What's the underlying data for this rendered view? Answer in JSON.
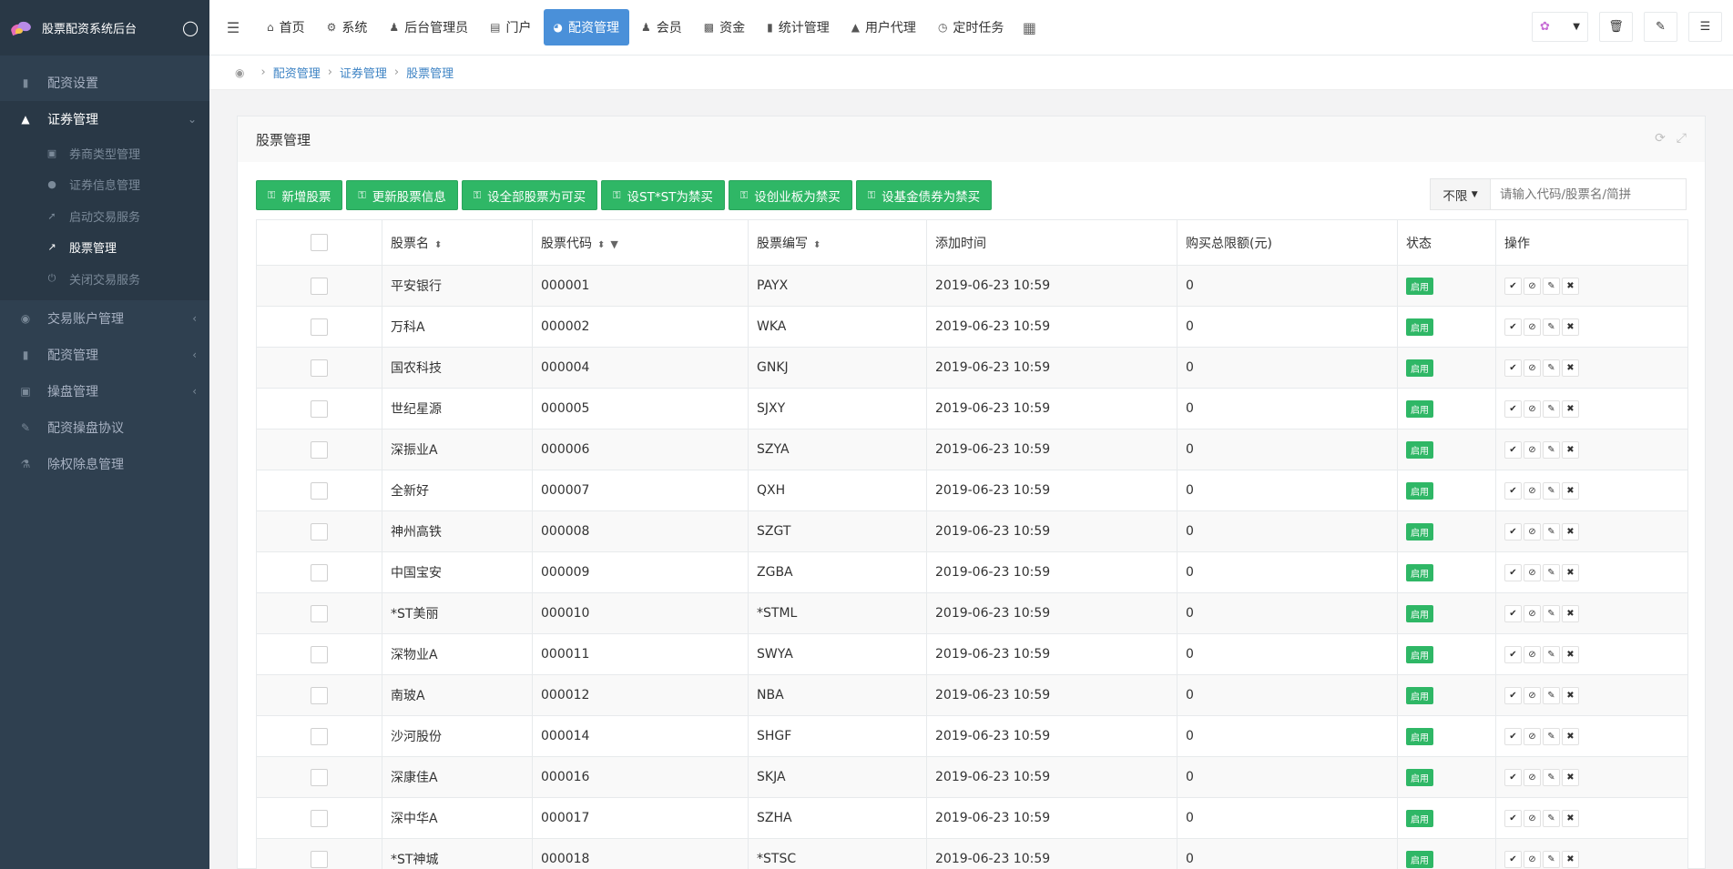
{
  "app": {
    "title": "股票配资系统后台"
  },
  "sidebar": {
    "items": [
      {
        "label": "配资设置",
        "icon": "signal-icon"
      },
      {
        "label": "证券管理",
        "icon": "area-chart-icon",
        "active": true
      },
      {
        "label": "交易账户管理",
        "icon": "user-circle-icon"
      },
      {
        "label": "配资管理",
        "icon": "thermometer-icon"
      },
      {
        "label": "操盘管理",
        "icon": "bank-icon"
      },
      {
        "label": "配资操盘协议",
        "icon": "pencil-icon"
      },
      {
        "label": "除权除息管理",
        "icon": "flask-icon"
      }
    ],
    "subitems": [
      {
        "label": "券商类型管理",
        "icon": "bank-icon"
      },
      {
        "label": "证券信息管理",
        "icon": "user-icon"
      },
      {
        "label": "启动交易服务",
        "icon": "rocket-icon"
      },
      {
        "label": "股票管理",
        "icon": "line-chart-icon",
        "active": true
      },
      {
        "label": "关闭交易服务",
        "icon": "power-icon"
      }
    ]
  },
  "topnav": {
    "items": [
      {
        "label": "首页",
        "icon": "home-icon"
      },
      {
        "label": "系统",
        "icon": "gear-icon"
      },
      {
        "label": "后台管理员",
        "icon": "user-icon"
      },
      {
        "label": "门户",
        "icon": "newspaper-icon"
      },
      {
        "label": "配资管理",
        "icon": "pie-chart-icon",
        "active": true
      },
      {
        "label": "会员",
        "icon": "users-icon"
      },
      {
        "label": "资金",
        "icon": "money-icon"
      },
      {
        "label": "统计管理",
        "icon": "bar-chart-icon"
      },
      {
        "label": "用户代理",
        "icon": "sitemap-icon"
      },
      {
        "label": "定时任务",
        "icon": "clock-icon"
      }
    ]
  },
  "breadcrumb": [
    "配资管理",
    "证券管理",
    "股票管理"
  ],
  "panel": {
    "title": "股票管理"
  },
  "toolbar": {
    "buttons": [
      "新增股票",
      "更新股票信息",
      "设全部股票为可买",
      "设ST*ST为禁买",
      "设创业板为禁买",
      "设基金债券为禁买"
    ]
  },
  "search": {
    "select": "不限",
    "placeholder": "请输入代码/股票名/简拼"
  },
  "table": {
    "headers": [
      "股票名",
      "股票代码",
      "股票编写",
      "添加时间",
      "购买总限额(元)",
      "状态",
      "操作"
    ],
    "rows": [
      {
        "name": "平安银行",
        "code": "000001",
        "abbr": "PAYX",
        "time": "2019-06-23 10:59",
        "limit": "0",
        "status": "启用"
      },
      {
        "name": "万科A",
        "code": "000002",
        "abbr": "WKA",
        "time": "2019-06-23 10:59",
        "limit": "0",
        "status": "启用"
      },
      {
        "name": "国农科技",
        "code": "000004",
        "abbr": "GNKJ",
        "time": "2019-06-23 10:59",
        "limit": "0",
        "status": "启用"
      },
      {
        "name": "世纪星源",
        "code": "000005",
        "abbr": "SJXY",
        "time": "2019-06-23 10:59",
        "limit": "0",
        "status": "启用"
      },
      {
        "name": "深振业A",
        "code": "000006",
        "abbr": "SZYA",
        "time": "2019-06-23 10:59",
        "limit": "0",
        "status": "启用"
      },
      {
        "name": "全新好",
        "code": "000007",
        "abbr": "QXH",
        "time": "2019-06-23 10:59",
        "limit": "0",
        "status": "启用"
      },
      {
        "name": "神州高铁",
        "code": "000008",
        "abbr": "SZGT",
        "time": "2019-06-23 10:59",
        "limit": "0",
        "status": "启用"
      },
      {
        "name": "中国宝安",
        "code": "000009",
        "abbr": "ZGBA",
        "time": "2019-06-23 10:59",
        "limit": "0",
        "status": "启用"
      },
      {
        "name": "*ST美丽",
        "code": "000010",
        "abbr": "*STML",
        "time": "2019-06-23 10:59",
        "limit": "0",
        "status": "启用"
      },
      {
        "name": "深物业A",
        "code": "000011",
        "abbr": "SWYA",
        "time": "2019-06-23 10:59",
        "limit": "0",
        "status": "启用"
      },
      {
        "name": "南玻A",
        "code": "000012",
        "abbr": "NBA",
        "time": "2019-06-23 10:59",
        "limit": "0",
        "status": "启用"
      },
      {
        "name": "沙河股份",
        "code": "000014",
        "abbr": "SHGF",
        "time": "2019-06-23 10:59",
        "limit": "0",
        "status": "启用"
      },
      {
        "name": "深康佳A",
        "code": "000016",
        "abbr": "SKJA",
        "time": "2019-06-23 10:59",
        "limit": "0",
        "status": "启用"
      },
      {
        "name": "深中华A",
        "code": "000017",
        "abbr": "SZHA",
        "time": "2019-06-23 10:59",
        "limit": "0",
        "status": "启用"
      },
      {
        "name": "*ST神城",
        "code": "000018",
        "abbr": "*STSC",
        "time": "2019-06-23 10:59",
        "limit": "0",
        "status": "启用"
      }
    ]
  },
  "colors": {
    "sidebar": "#2f4050",
    "active_tab": "#4a90d9",
    "green": "#2fb766",
    "link": "#3d83c4"
  }
}
